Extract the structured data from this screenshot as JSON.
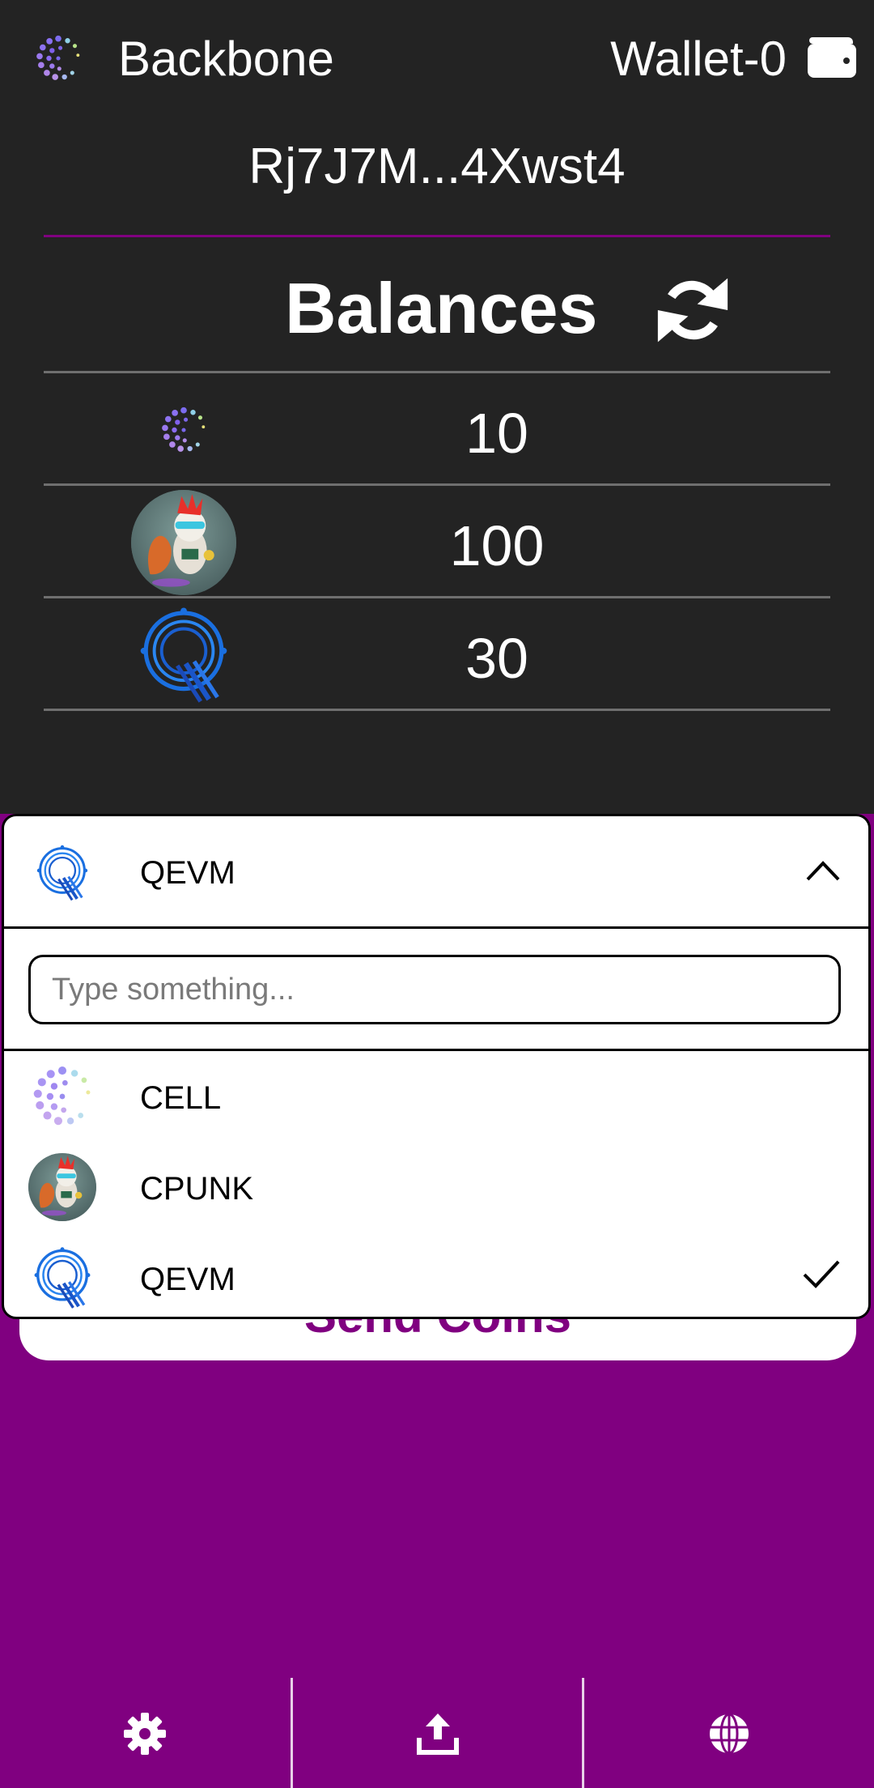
{
  "header": {
    "app_title": "Backbone",
    "wallet_name": "Wallet-0",
    "logo_icon": "backbone-logo-icon",
    "wallet_icon": "wallet-icon"
  },
  "address": "Rj7J7M...4Xwst4",
  "balances": {
    "title": "Balances",
    "refresh_icon": "refresh-icon",
    "rows": [
      {
        "token_icon": "cell-token-icon",
        "amount": "10"
      },
      {
        "token_icon": "cpunk-token-icon",
        "amount": "100"
      },
      {
        "token_icon": "qevm-token-icon",
        "amount": "30"
      }
    ]
  },
  "token_select": {
    "selected": "QEVM",
    "search_placeholder": "Type something...",
    "options": [
      {
        "label": "CELL",
        "selected": false
      },
      {
        "label": "CPUNK",
        "selected": false
      },
      {
        "label": "QEVM",
        "selected": true
      }
    ]
  },
  "send_button": {
    "label": "Send Coins"
  },
  "bottom_nav": {
    "items": [
      {
        "icon": "gear-icon"
      },
      {
        "icon": "upload-icon"
      },
      {
        "icon": "globe-icon"
      }
    ]
  },
  "colors": {
    "accent": "#800080",
    "dark_bg": "#232323",
    "divider": "#6f6f6f"
  }
}
